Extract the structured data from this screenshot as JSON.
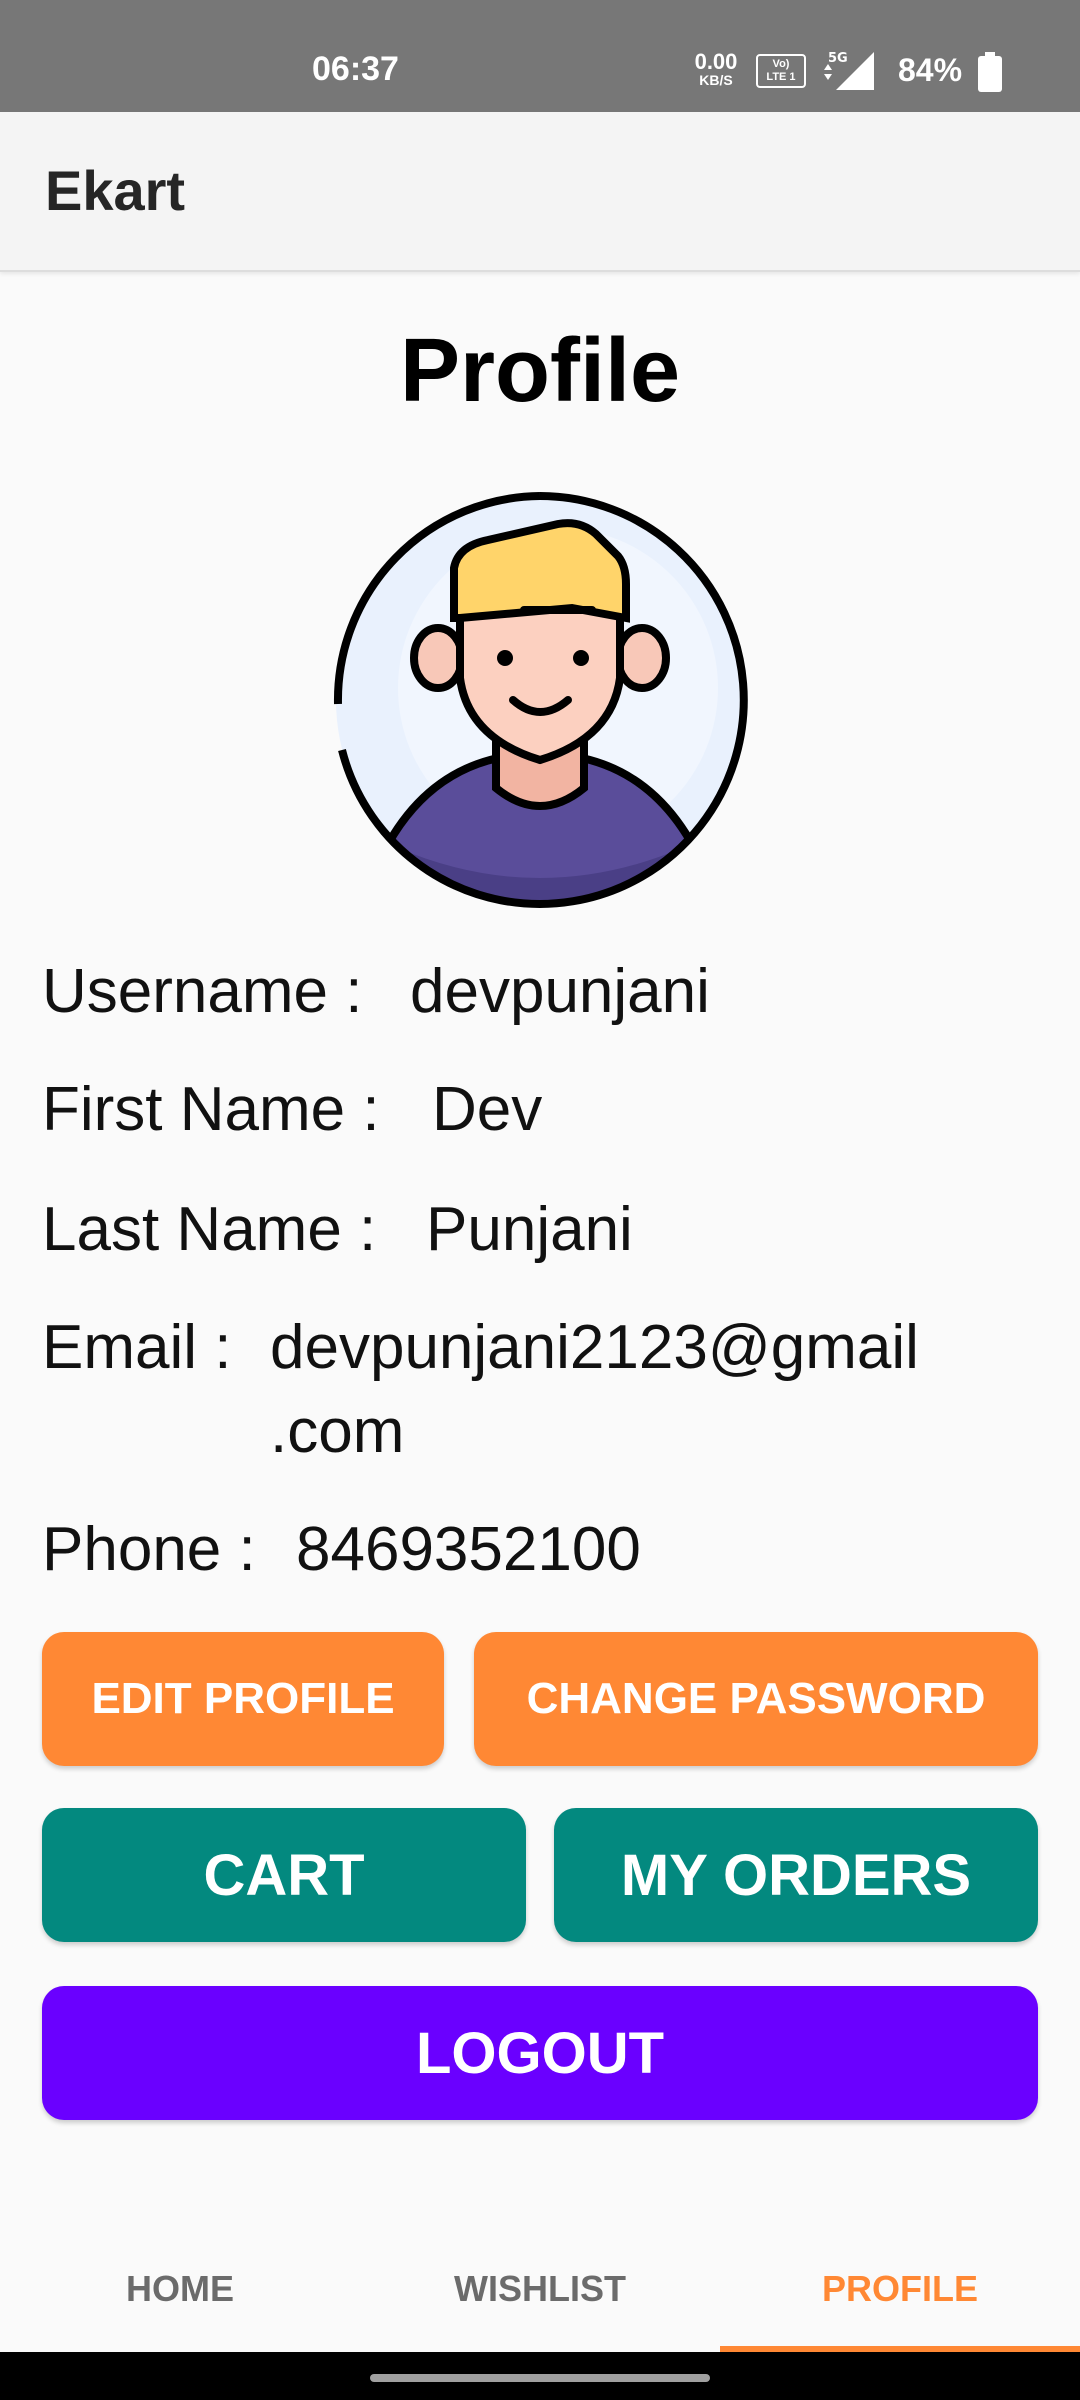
{
  "status_bar": {
    "time": "06:37",
    "net_speed_value": "0.00",
    "net_speed_unit": "KB/S",
    "volte_line1": "Vo)",
    "volte_line2": "LTE 1",
    "network_type": "5G",
    "battery": "84%"
  },
  "app_bar": {
    "title": "Ekart"
  },
  "profile": {
    "title": "Profile",
    "fields": {
      "username_label": "Username :",
      "username_value": "devpunjani",
      "first_name_label": "First Name :",
      "first_name_value": "Dev",
      "last_name_label": "Last Name :",
      "last_name_value": "Punjani",
      "email_label": "Email :",
      "email_value_line1": "devpunjani2123@gmail",
      "email_value_line2": ".com",
      "phone_label": "Phone :",
      "phone_value": "8469352100"
    }
  },
  "buttons": {
    "edit_profile": "EDIT PROFILE",
    "change_password": "CHANGE PASSWORD",
    "cart": "CART",
    "my_orders": "MY ORDERS",
    "logout": "LOGOUT"
  },
  "bottom_nav": {
    "items": [
      {
        "label": "HOME"
      },
      {
        "label": "WISHLIST"
      },
      {
        "label": "PROFILE"
      }
    ],
    "active": "PROFILE"
  },
  "colors": {
    "accent_orange": "#ff8834",
    "teal": "#03897f",
    "purple": "#6a00ff"
  },
  "icons": {
    "avatar": "user-avatar-icon",
    "signal": "signal-icon",
    "battery": "battery-icon"
  }
}
